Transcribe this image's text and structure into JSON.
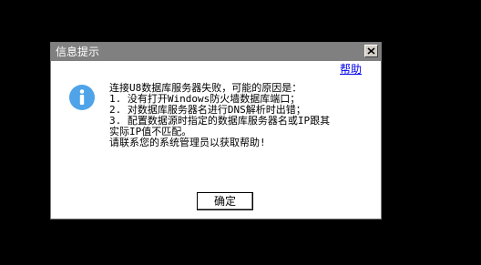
{
  "dialog": {
    "title": "信息提示",
    "help_link": "帮助",
    "message_lines": [
      "连接U8数据库服务器失败，可能的原因是：",
      "1. 没有打开Windows防火墙数据库端口；",
      "2. 对数据库服务器名进行DNS解析时出错；",
      "3. 配置数据源时指定的数据库服务器名或IP跟其",
      "实际IP值不匹配。",
      "请联系您的系统管理员以获取帮助!"
    ],
    "ok_button": "确定",
    "icon": "info-icon",
    "close_icon": "close-icon"
  },
  "colors": {
    "background": "#000000",
    "titlebar": "#808080",
    "info_icon": "#4fa3e8",
    "link": "#0000ee"
  }
}
